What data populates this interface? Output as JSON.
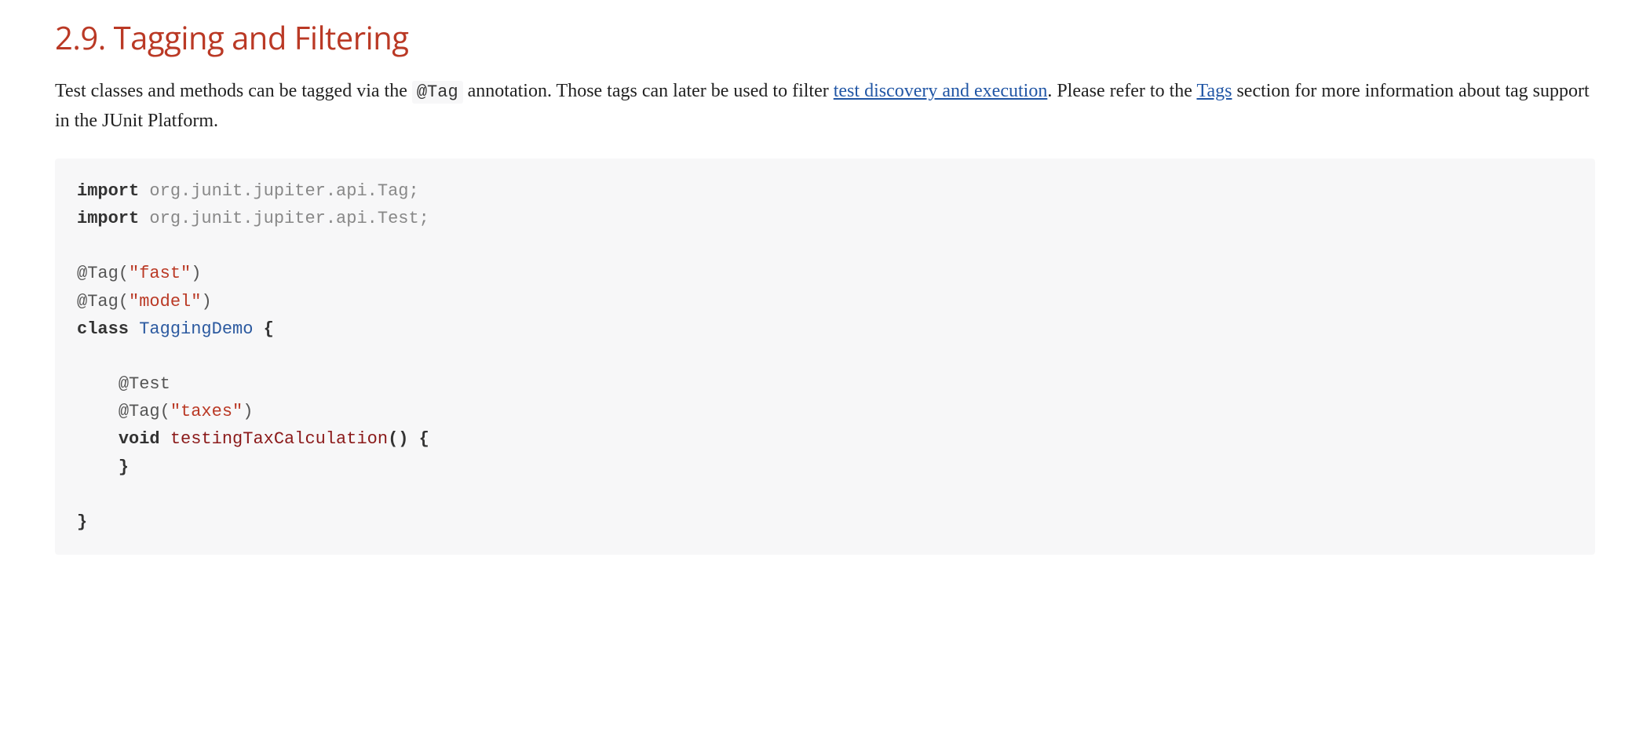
{
  "heading": "2.9. Tagging and Filtering",
  "para": {
    "t1": "Test classes and methods can be tagged via the ",
    "code1": "@Tag",
    "t2": " annotation. Those tags can later be used to filter ",
    "link1": "test discovery and execution",
    "t3": ". Please refer to the ",
    "link2": "Tags",
    "t4": " section for more information about tag support in the JUnit Platform."
  },
  "code": {
    "kw_import1": "import",
    "pkg1": " org.junit.jupiter.api.Tag;",
    "kw_import2": "import",
    "pkg2": " org.junit.jupiter.api.Test;",
    "ann_tag1a": "@Tag(",
    "str_fast": "\"fast\"",
    "ann_tag1b": ")",
    "ann_tag2a": "@Tag(",
    "str_model": "\"model\"",
    "ann_tag2b": ")",
    "kw_class": "class",
    "cls_name": " TaggingDemo ",
    "brace_open": "{",
    "ann_test": "@Test",
    "ann_tag3a": "@Tag(",
    "str_taxes": "\"taxes\"",
    "ann_tag3b": ")",
    "kw_void": "void",
    "mth_name": " testingTaxCalculation",
    "paren": "()",
    "brace_m_open": " {",
    "brace_m_close": "}",
    "brace_close": "}"
  }
}
